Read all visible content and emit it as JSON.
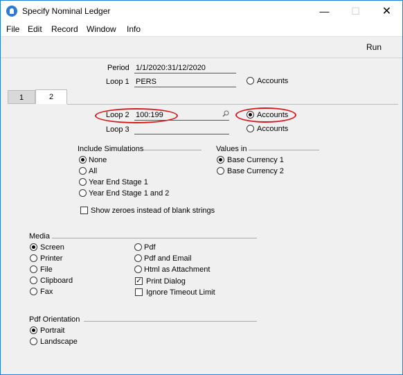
{
  "window": {
    "title": "Specify Nominal Ledger",
    "controls": {
      "minimize": "—",
      "maximize": "☐",
      "close": "✕"
    }
  },
  "menu": {
    "items": [
      "File",
      "Edit",
      "Record",
      "Window",
      "Info"
    ]
  },
  "toolbar": {
    "run_label": "Run"
  },
  "period": {
    "label": "Period",
    "value": "1/1/2020:31/12/2020"
  },
  "loop1": {
    "label": "Loop 1",
    "value": "PERS",
    "accounts_label": "Accounts",
    "accounts_selected": false
  },
  "tabs": [
    {
      "label": "1"
    },
    {
      "label": "2"
    }
  ],
  "loop2": {
    "label": "Loop 2",
    "value": "100:199",
    "accounts_label": "Accounts",
    "accounts_selected": true
  },
  "loop3": {
    "label": "Loop 3",
    "value": "",
    "accounts_label": "Accounts",
    "accounts_selected": false
  },
  "include_simulations": {
    "label": "Include Simulations",
    "options": [
      {
        "label": "None",
        "selected": true
      },
      {
        "label": "All",
        "selected": false
      },
      {
        "label": "Year End Stage 1",
        "selected": false
      },
      {
        "label": "Year End Stage 1 and 2",
        "selected": false
      }
    ]
  },
  "values_in": {
    "label": "Values in",
    "options": [
      {
        "label": "Base Currency 1",
        "selected": true
      },
      {
        "label": "Base Currency 2",
        "selected": false
      }
    ]
  },
  "show_zeroes": {
    "label": "Show zeroes instead of blank strings",
    "checked": false
  },
  "media": {
    "label": "Media",
    "left_options": [
      {
        "label": "Screen",
        "selected": true
      },
      {
        "label": "Printer",
        "selected": false
      },
      {
        "label": "File",
        "selected": false
      },
      {
        "label": "Clipboard",
        "selected": false
      },
      {
        "label": "Fax",
        "selected": false
      }
    ],
    "right_options": [
      {
        "label": "Pdf",
        "selected": false
      },
      {
        "label": "Pdf and Email",
        "selected": false
      },
      {
        "label": "Html as Attachment",
        "selected": false
      }
    ],
    "print_dialog": {
      "label": "Print Dialog",
      "checked": true
    },
    "ignore_timeout": {
      "label": "Ignore Timeout Limit",
      "checked": false
    }
  },
  "pdf_orientation": {
    "label": "Pdf Orientation",
    "options": [
      {
        "label": "Portrait",
        "selected": true
      },
      {
        "label": "Landscape",
        "selected": false
      }
    ]
  },
  "colors": {
    "highlight": "#d4181e",
    "window_border": "#1f7fd6"
  }
}
